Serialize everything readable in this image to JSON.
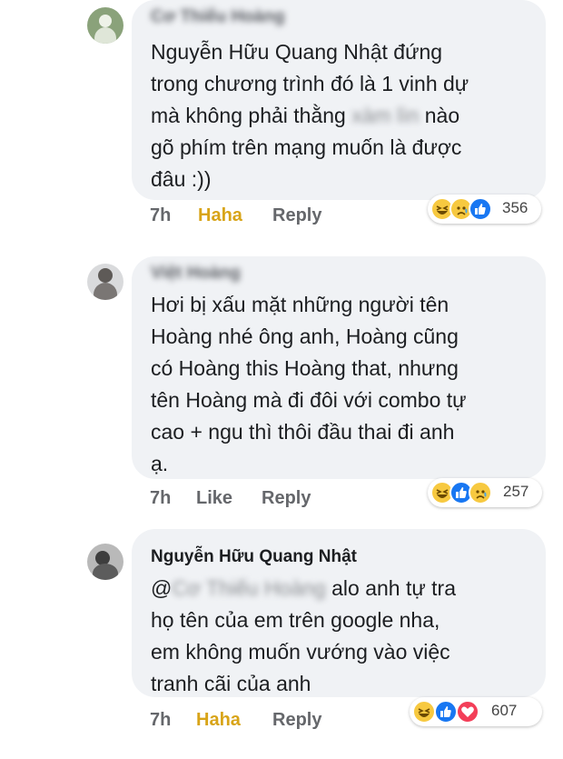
{
  "comments": [
    {
      "author": "Cơ Thiếu Hoàng",
      "lines": [
        [
          "Nguyễn Hữu Quang Nhật đứng"
        ],
        [
          "trong chương trình đó là 1 vinh dự"
        ],
        [
          "mà không phải thằng ",
          "xàm lìn",
          " nào"
        ],
        [
          "gõ phím trên mạng muốn là được"
        ],
        [
          "đâu :))"
        ]
      ],
      "time": "7h",
      "reaction_label": "Haha",
      "reply_label": "Reply",
      "reaction_count": "356",
      "reaction_icons": [
        "haha-icon",
        "sad-icon",
        "like-icon"
      ]
    },
    {
      "author": "Việt Hoàng",
      "lines": [
        [
          "Hơi bị xấu mặt những người tên"
        ],
        [
          "Hoàng nhé ông anh, Hoàng cũng"
        ],
        [
          "có Hoàng this Hoàng that, nhưng"
        ],
        [
          "tên Hoàng mà đi đôi với combo tự"
        ],
        [
          "cao + ngu thì thôi đầu thai đi anh"
        ],
        [
          "ạ."
        ]
      ],
      "time": "7h",
      "reaction_label": "Like",
      "reply_label": "Reply",
      "reaction_count": "257",
      "reaction_icons": [
        "haha-icon",
        "like-icon",
        "sad-icon"
      ]
    },
    {
      "author": "Nguyễn Hữu Quang Nhật",
      "lines": [
        [
          "@",
          "Cơ Thiếu Hoàng",
          " alo anh tự tra"
        ],
        [
          "họ tên của em trên google nha,"
        ],
        [
          "em không muốn vướng vào việc"
        ],
        [
          "tranh cãi của anh"
        ]
      ],
      "time": "7h",
      "reaction_label": "Haha",
      "reply_label": "Reply",
      "reaction_count": "607",
      "reaction_icons": [
        "haha-icon",
        "like-icon",
        "love-icon"
      ]
    }
  ],
  "colors": {
    "bubble": "#f0f2f5",
    "haha_active": "#d8a418",
    "meta": "#65676b",
    "like_blue": "#1877f2",
    "love_red": "#f33e58",
    "emoji_yellow": "#f7c940"
  }
}
